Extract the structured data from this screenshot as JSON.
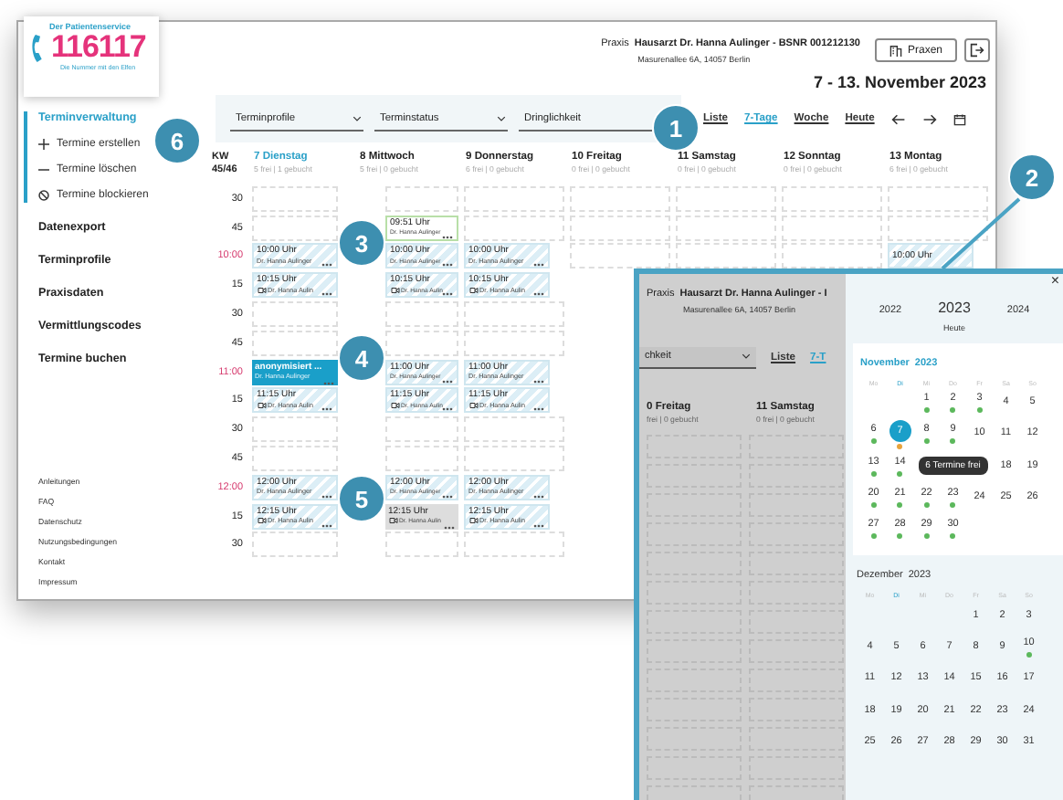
{
  "header": {
    "logo": {
      "tagline_top": "Der Patientenservice",
      "number": "116117",
      "tagline_bottom": "Die Nummer mit den Elfen"
    },
    "practice_label": "Praxis",
    "practice_name": "Hausarzt Dr. Hanna Aulinger - BSNR 001212130",
    "address": "Masurenallee 6A, 14057 Berlin",
    "practices_button": "Praxen",
    "date_range": "7 - 13. November 2023"
  },
  "sidebar": {
    "items": [
      {
        "label": "Terminverwaltung",
        "selected": true,
        "children": [
          {
            "label": "Termine erstellen",
            "kind": "add"
          },
          {
            "label": "Termine löschen",
            "kind": "remove"
          },
          {
            "label": "Termine blockieren",
            "kind": "block"
          }
        ]
      },
      {
        "label": "Datenexport",
        "selected": false
      },
      {
        "label": "Terminprofile",
        "selected": false
      },
      {
        "label": "Praxisdaten",
        "selected": false
      },
      {
        "label": "Vermittlungscodes",
        "selected": false
      },
      {
        "label": "Termine buchen",
        "selected": false
      }
    ],
    "footer_links": [
      "Anleitungen",
      "FAQ",
      "Datenschutz",
      "Nutzungsbedingungen",
      "Kontakt",
      "Impressum"
    ]
  },
  "filters": [
    {
      "label": "Terminprofile",
      "chevron": true
    },
    {
      "label": "Terminstatus",
      "chevron": true
    },
    {
      "label": "Dringlichkeit",
      "chevron": false
    }
  ],
  "views": [
    {
      "label": "Liste",
      "selected": false
    },
    {
      "label": "7-Tage",
      "selected": true
    },
    {
      "label": "Woche",
      "selected": false
    },
    {
      "label": "Heute",
      "selected": false
    }
  ],
  "calendar": {
    "week_label": "KW",
    "week_number": "45/46",
    "days": [
      {
        "name": "7 Dienstag",
        "stats": "5 frei | 1 gebucht",
        "selected": true
      },
      {
        "name": "8 Mittwoch",
        "stats": "5 frei | 0 gebucht",
        "selected": false
      },
      {
        "name": "9 Donnerstag",
        "stats": "6 frei | 0 gebucht",
        "selected": false
      },
      {
        "name": "10 Freitag",
        "stats": "0 frei | 0 gebucht",
        "selected": false
      },
      {
        "name": "11 Samstag",
        "stats": "0 frei | 0 gebucht",
        "selected": false
      },
      {
        "name": "12 Sonntag",
        "stats": "0 frei | 0 gebucht",
        "selected": false
      },
      {
        "name": "13 Montag",
        "stats": "6 frei | 0 gebucht",
        "selected": false
      }
    ],
    "rows": [
      {
        "label": "30",
        "hour": false,
        "cells": [
          null,
          null,
          null,
          null,
          null,
          null,
          null
        ]
      },
      {
        "label": "45",
        "hour": false,
        "cells": [
          null,
          {
            "kind": "extra",
            "title": "09:51 Uhr",
            "doctor": "Dr. Hanna Aulinger",
            "video": false
          },
          null,
          null,
          null,
          null,
          null
        ]
      },
      {
        "label": "10:00",
        "hour": true,
        "cells": [
          {
            "kind": "free",
            "title": "10:00 Uhr",
            "doctor": "Dr. Hanna Aulinger",
            "video": false
          },
          {
            "kind": "free",
            "title": "10:00 Uhr",
            "doctor": "Dr. Hanna Aulinger",
            "video": false
          },
          {
            "kind": "free",
            "title": "10:00 Uhr",
            "doctor": "Dr. Hanna Aulinger",
            "video": false
          },
          null,
          null,
          null,
          {
            "kind": "free",
            "title": "10:00 Uhr"
          }
        ]
      },
      {
        "label": "15",
        "hour": false,
        "cells": [
          {
            "kind": "free",
            "title": "10:15 Uhr",
            "doctor": "Dr. Hanna Aulin",
            "video": true
          },
          {
            "kind": "free",
            "title": "10:15 Uhr",
            "doctor": "Dr. Hanna Aulin",
            "video": true
          },
          {
            "kind": "free",
            "title": "10:15 Uhr",
            "doctor": "Dr. Hanna Aulin",
            "video": true
          }
        ]
      },
      {
        "label": "30",
        "hour": false,
        "cells": [
          null,
          null,
          null
        ]
      },
      {
        "label": "45",
        "hour": false,
        "cells": [
          null,
          null,
          null
        ]
      },
      {
        "label": "11:00",
        "hour": true,
        "cells": [
          {
            "kind": "booked",
            "title": "anonymisiert ...",
            "doctor": "Dr. Hanna Aulinger",
            "video": false
          },
          {
            "kind": "free",
            "title": "11:00 Uhr",
            "doctor": "Dr. Hanna Aulinger",
            "video": false
          },
          {
            "kind": "free",
            "title": "11:00 Uhr",
            "doctor": "Dr. Hanna Aulinger",
            "video": false
          }
        ]
      },
      {
        "label": "15",
        "hour": false,
        "cells": [
          {
            "kind": "free",
            "title": "11:15 Uhr",
            "doctor": "Dr. Hanna Aulin",
            "video": true
          },
          {
            "kind": "free",
            "title": "11:15 Uhr",
            "doctor": "Dr. Hanna Aulin",
            "video": true
          },
          {
            "kind": "free",
            "title": "11:15 Uhr",
            "doctor": "Dr. Hanna Aulin",
            "video": true
          }
        ]
      },
      {
        "label": "30",
        "hour": false,
        "cells": [
          null,
          null,
          null
        ]
      },
      {
        "label": "45",
        "hour": false,
        "cells": [
          null,
          null,
          null
        ]
      },
      {
        "label": "12:00",
        "hour": true,
        "cells": [
          {
            "kind": "free",
            "title": "12:00 Uhr",
            "doctor": "Dr. Hanna Aulinger",
            "video": false
          },
          {
            "kind": "free",
            "title": "12:00 Uhr",
            "doctor": "Dr. Hanna Aulinger",
            "video": false
          },
          {
            "kind": "free",
            "title": "12:00 Uhr",
            "doctor": "Dr. Hanna Aulinger",
            "video": false
          }
        ]
      },
      {
        "label": "15",
        "hour": false,
        "cells": [
          {
            "kind": "free",
            "title": "12:15 Uhr",
            "doctor": "Dr. Hanna Aulin",
            "video": true
          },
          {
            "kind": "blocked",
            "title": "12:15 Uhr",
            "doctor": "Dr. Hanna Aulin",
            "video": true
          },
          {
            "kind": "free",
            "title": "12:15 Uhr",
            "doctor": "Dr. Hanna Aulin",
            "video": true
          }
        ]
      },
      {
        "label": "30",
        "hour": false,
        "cells": [
          null,
          null,
          null
        ]
      }
    ]
  },
  "inset": {
    "background": {
      "practice_label": "Praxis",
      "practice_name": "Hausarzt Dr. Hanna Aulinger - I",
      "address": "Masurenallee 6A, 14057 Berlin",
      "filter": "chkeit",
      "views": [
        {
          "label": "Liste",
          "selected": false
        },
        {
          "label": "7-T",
          "selected": true
        }
      ],
      "days": [
        {
          "name": "0 Freitag",
          "stats": "frei | 0 gebucht"
        },
        {
          "name": "11 Samstag",
          "stats": "0 frei | 0 gebucht"
        }
      ]
    },
    "datepicker": {
      "close": "×",
      "years": [
        {
          "label": "2022",
          "selected": false
        },
        {
          "label": "2023",
          "selected": true
        },
        {
          "label": "2024",
          "selected": false
        }
      ],
      "today": "Heute",
      "months": [
        {
          "name": "November",
          "year": "2023",
          "current": true,
          "weekdays": [
            {
              "label": "Mo",
              "selected": false
            },
            {
              "label": "Di",
              "selected": true
            },
            {
              "label": "Mi",
              "selected": false
            },
            {
              "label": "Do",
              "selected": false
            },
            {
              "label": "Fr",
              "selected": false
            },
            {
              "label": "Sa",
              "selected": false
            },
            {
              "label": "So",
              "selected": false
            }
          ],
          "weeks": [
            [
              {
                "kind": "blank"
              },
              {
                "kind": "blank"
              },
              {
                "kind": "day",
                "label": "1",
                "selected": false,
                "color": "#5cb85c"
              },
              {
                "kind": "day",
                "label": "2",
                "selected": false,
                "color": "#5cb85c"
              },
              {
                "kind": "day",
                "label": "3",
                "selected": false,
                "color": "#5cb85c"
              },
              {
                "kind": "day",
                "label": "4",
                "selected": false
              },
              {
                "kind": "day",
                "label": "5",
                "selected": false
              }
            ],
            [
              {
                "kind": "day",
                "label": "6",
                "selected": false,
                "color": "#5cb85c"
              },
              {
                "kind": "day",
                "label": "7",
                "selected": true,
                "color": "#e8a33c"
              },
              {
                "kind": "day",
                "label": "8",
                "selected": false,
                "color": "#5cb85c"
              },
              {
                "kind": "day",
                "label": "9",
                "selected": false,
                "color": "#5cb85c"
              },
              {
                "kind": "day",
                "label": "10",
                "selected": false
              },
              {
                "kind": "day",
                "label": "11",
                "selected": false
              },
              {
                "kind": "day",
                "label": "12",
                "selected": false
              }
            ],
            [
              {
                "kind": "day",
                "label": "13",
                "selected": false,
                "color": "#5cb85c"
              },
              {
                "kind": "day",
                "label": "14",
                "selected": false,
                "color": "#5cb85c"
              },
              {
                "kind": "tooltip",
                "text": "6 Termine frei"
              },
              {
                "kind": "day",
                "label": "18",
                "selected": false
              },
              {
                "kind": "day",
                "label": "19",
                "selected": false
              }
            ],
            [
              {
                "kind": "day",
                "label": "20",
                "selected": false,
                "color": "#5cb85c"
              },
              {
                "kind": "day",
                "label": "21",
                "selected": false,
                "color": "#5cb85c"
              },
              {
                "kind": "day",
                "label": "22",
                "selected": false,
                "color": "#5cb85c"
              },
              {
                "kind": "day",
                "label": "23",
                "selected": false,
                "color": "#5cb85c"
              },
              {
                "kind": "day",
                "label": "24",
                "selected": false
              },
              {
                "kind": "day",
                "label": "25",
                "selected": false
              },
              {
                "kind": "day",
                "label": "26",
                "selected": false
              }
            ],
            [
              {
                "kind": "day",
                "label": "27",
                "selected": false,
                "color": "#5cb85c"
              },
              {
                "kind": "day",
                "label": "28",
                "selected": false,
                "color": "#5cb85c"
              },
              {
                "kind": "day",
                "label": "29",
                "selected": false,
                "color": "#5cb85c"
              },
              {
                "kind": "day",
                "label": "30",
                "selected": false,
                "color": "#5cb85c"
              }
            ]
          ]
        },
        {
          "name": "Dezember",
          "year": "2023",
          "current": false,
          "weekdays": [
            {
              "label": "Mo",
              "selected": false
            },
            {
              "label": "Di",
              "selected": true
            },
            {
              "label": "Mi",
              "selected": false
            },
            {
              "label": "Do",
              "selected": false
            },
            {
              "label": "Fr",
              "selected": false
            },
            {
              "label": "Sa",
              "selected": false
            },
            {
              "label": "So",
              "selected": false
            }
          ],
          "weeks": [
            [
              {
                "kind": "blank"
              },
              {
                "kind": "blank"
              },
              {
                "kind": "blank"
              },
              {
                "kind": "blank"
              },
              {
                "kind": "day",
                "label": "1",
                "selected": false
              },
              {
                "kind": "day",
                "label": "2",
                "selected": false
              },
              {
                "kind": "day",
                "label": "3",
                "selected": false
              }
            ],
            [
              {
                "kind": "day",
                "label": "4",
                "selected": false
              },
              {
                "kind": "day",
                "label": "5",
                "selected": false
              },
              {
                "kind": "day",
                "label": "6",
                "selected": false
              },
              {
                "kind": "day",
                "label": "7",
                "selected": false
              },
              {
                "kind": "day",
                "label": "8",
                "selected": false
              },
              {
                "kind": "day",
                "label": "9",
                "selected": false
              },
              {
                "kind": "day",
                "label": "10",
                "selected": false,
                "color": "#5cb85c"
              }
            ],
            [
              {
                "kind": "day",
                "label": "11",
                "selected": false
              },
              {
                "kind": "day",
                "label": "12",
                "selected": false
              },
              {
                "kind": "day",
                "label": "13",
                "selected": false
              },
              {
                "kind": "day",
                "label": "14",
                "selected": false
              },
              {
                "kind": "day",
                "label": "15",
                "selected": false
              },
              {
                "kind": "day",
                "label": "16",
                "selected": false
              },
              {
                "kind": "day",
                "label": "17",
                "selected": false
              }
            ],
            [
              {
                "kind": "day",
                "label": "18",
                "selected": false
              },
              {
                "kind": "day",
                "label": "19",
                "selected": false
              },
              {
                "kind": "day",
                "label": "20",
                "selected": false
              },
              {
                "kind": "day",
                "label": "21",
                "selected": false
              },
              {
                "kind": "day",
                "label": "22",
                "selected": false
              },
              {
                "kind": "day",
                "label": "23",
                "selected": false
              },
              {
                "kind": "day",
                "label": "24",
                "selected": false
              }
            ],
            [
              {
                "kind": "day",
                "label": "25",
                "selected": false
              },
              {
                "kind": "day",
                "label": "26",
                "selected": false
              },
              {
                "kind": "day",
                "label": "27",
                "selected": false
              },
              {
                "kind": "day",
                "label": "28",
                "selected": false
              },
              {
                "kind": "day",
                "label": "29",
                "selected": false
              },
              {
                "kind": "day",
                "label": "30",
                "selected": false
              },
              {
                "kind": "day",
                "label": "31",
                "selected": false
              }
            ]
          ]
        }
      ]
    }
  },
  "callouts": [
    "1",
    "2",
    "3",
    "4",
    "5",
    "6"
  ]
}
